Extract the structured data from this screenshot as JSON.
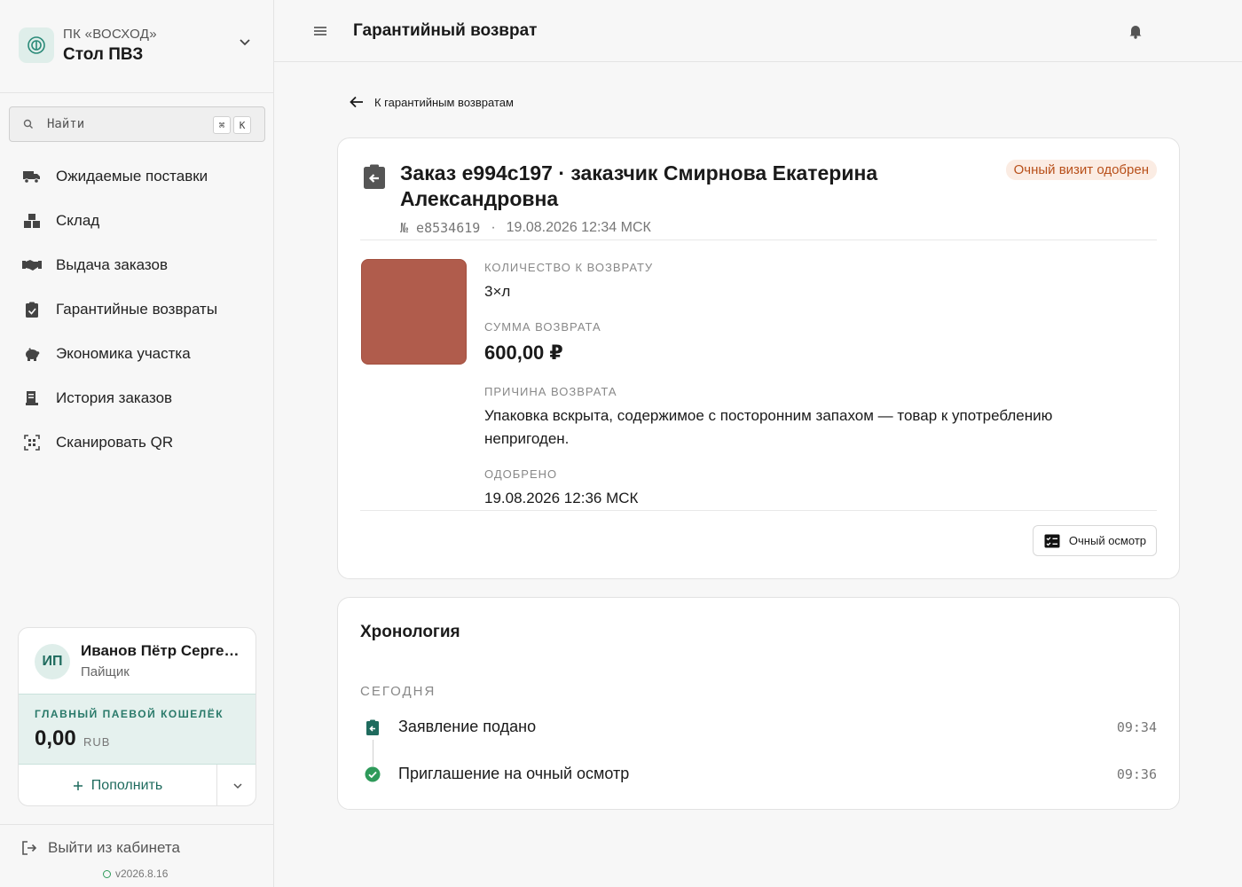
{
  "sidebar": {
    "org": "ПК «ВОСХОД»",
    "desk": "Стол ПВЗ",
    "search": {
      "placeholder": "Найти",
      "kbd1": "⌘",
      "kbd2": "K"
    },
    "items": [
      {
        "label": "Ожидаемые поставки",
        "icon": "truck-icon"
      },
      {
        "label": "Склад",
        "icon": "boxes-icon"
      },
      {
        "label": "Выдача заказов",
        "icon": "handshake-icon"
      },
      {
        "label": "Гарантийные возвраты",
        "icon": "clipboard-return-icon"
      },
      {
        "label": "Экономика участка",
        "icon": "piggy-bank-icon"
      },
      {
        "label": "История заказов",
        "icon": "receipt-icon"
      },
      {
        "label": "Сканировать QR",
        "icon": "qr-scan-icon"
      }
    ],
    "user": {
      "initials": "ИП",
      "name": "Иванов Пётр Сергеевич",
      "role": "Пайщик",
      "wallet_label": "ГЛАВНЫЙ ПАЕВОЙ КОШЕЛЁК",
      "wallet_amount": "0,00",
      "wallet_currency": "RUB",
      "topup_label": "Пополнить"
    },
    "logout_label": "Выйти из кабинета",
    "version": "v2026.8.16"
  },
  "topbar": {
    "title": "Гарантийный возврат"
  },
  "main": {
    "back_label": "К гарантийным возвратам",
    "order": {
      "title": "Заказ e994c197 · заказчик Смирнова Екатерина Александровна",
      "status": "Очный визит одобрен",
      "number": "№ e8534619",
      "separator": "·",
      "date": "19.08.2026 12:34 МСК",
      "qty_label": "КОЛИЧЕСТВО К ВОЗВРАТУ",
      "qty_value": "3×л",
      "sum_label": "СУММА ВОЗВРАТА",
      "sum_value": "600,00 ₽",
      "reason_label": "ПРИЧИНА ВОЗВРАТА",
      "reason_value": "Упаковка вскрыта, содержимое с посторонним запахом — товар к употреблению непригоден.",
      "approved_label": "ОДОБРЕНО",
      "approved_value": "19.08.2026 12:36 МСК",
      "inspect_label": "Очный осмотр",
      "thumb_color": "#b05c4c"
    },
    "timeline": {
      "title": "Хронология",
      "day": "СЕГОДНЯ",
      "events": [
        {
          "label": "Заявление подано",
          "time": "09:34"
        },
        {
          "label": "Приглашение на очный осмотр",
          "time": "09:36"
        }
      ]
    }
  },
  "colors": {
    "accent": "#1f6b5e",
    "status": "#b8501a",
    "success": "#2e9a5a"
  }
}
